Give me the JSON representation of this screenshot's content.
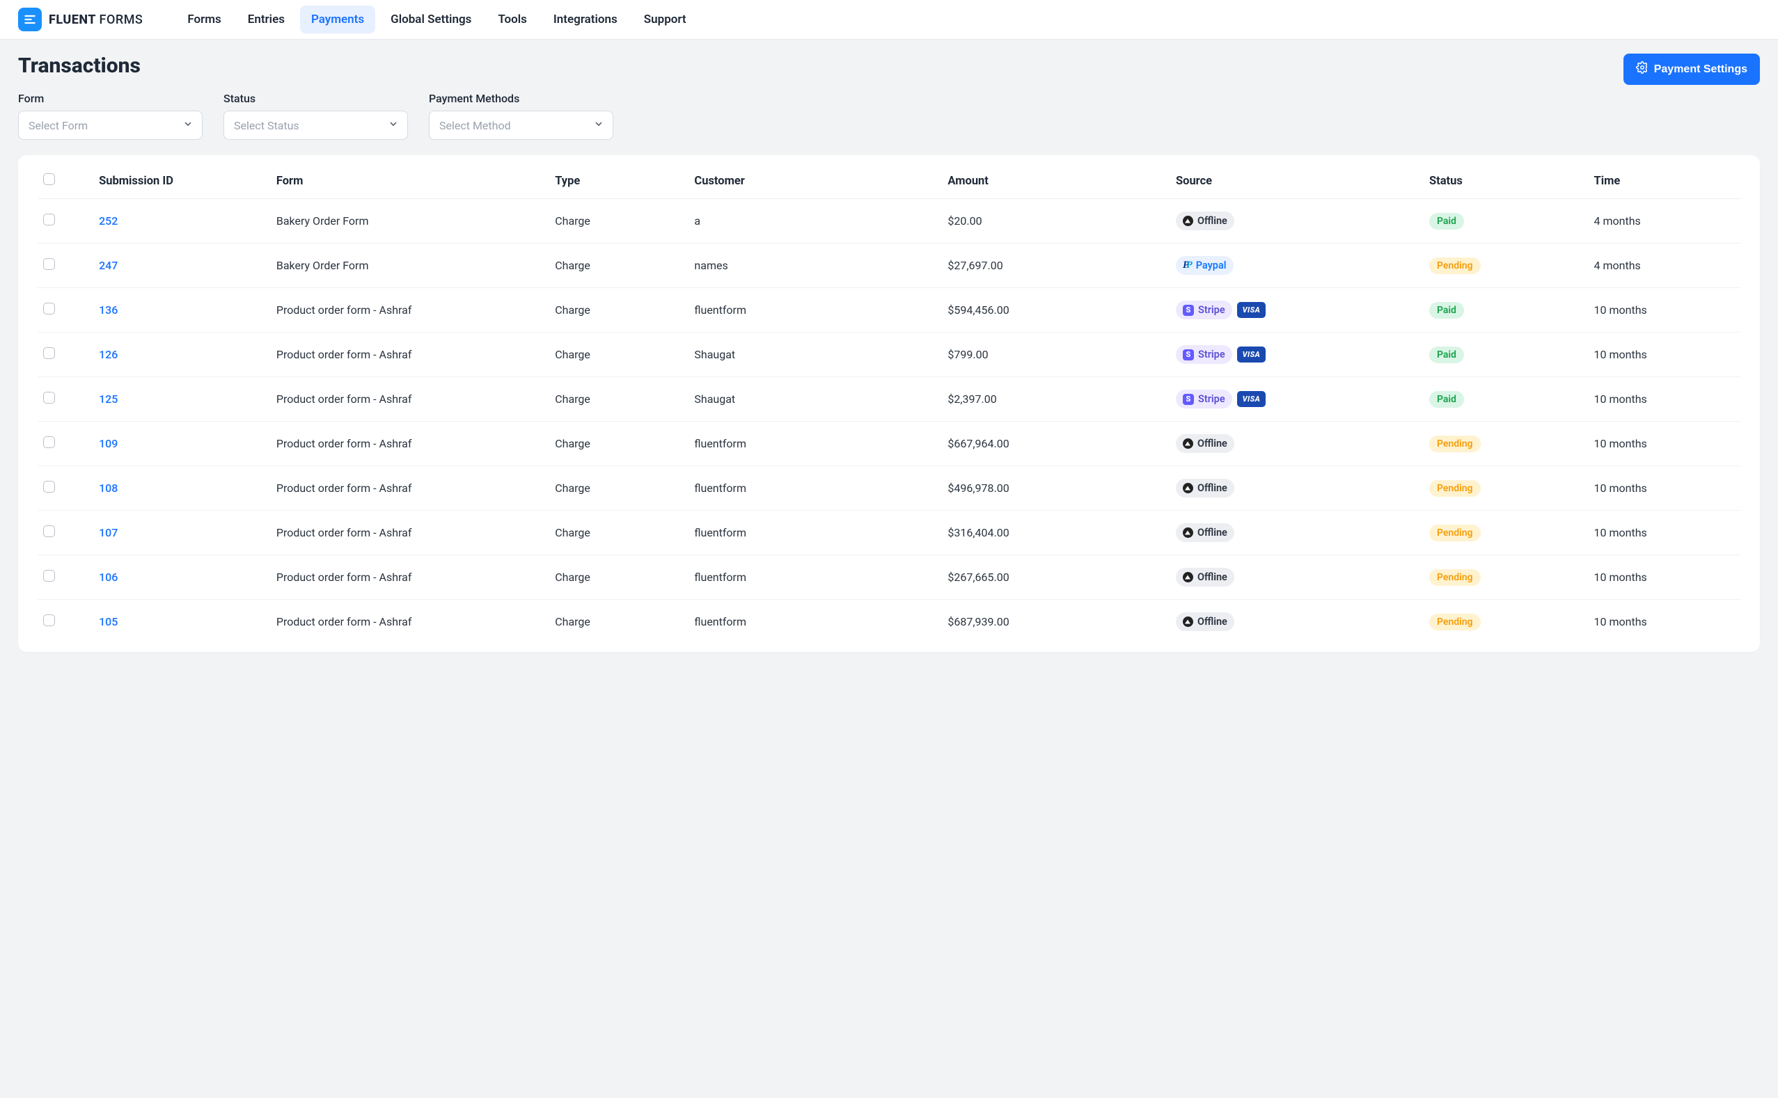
{
  "brand": {
    "name_bold": "FLUENT",
    "name_thin": "FORMS"
  },
  "nav": {
    "items": [
      {
        "label": "Forms"
      },
      {
        "label": "Entries"
      },
      {
        "label": "Payments",
        "active": true
      },
      {
        "label": "Global Settings"
      },
      {
        "label": "Tools"
      },
      {
        "label": "Integrations"
      },
      {
        "label": "Support"
      }
    ]
  },
  "page": {
    "title": "Transactions",
    "settings_button": "Payment Settings"
  },
  "filters": {
    "form": {
      "label": "Form",
      "placeholder": "Select Form"
    },
    "status": {
      "label": "Status",
      "placeholder": "Select Status"
    },
    "method": {
      "label": "Payment Methods",
      "placeholder": "Select Method"
    }
  },
  "table": {
    "columns": {
      "id": "Submission ID",
      "form": "Form",
      "type": "Type",
      "customer": "Customer",
      "amount": "Amount",
      "source": "Source",
      "status": "Status",
      "time": "Time"
    },
    "source_labels": {
      "offline": "Offline",
      "paypal": "Paypal",
      "stripe": "Stripe",
      "visa": "VISA"
    },
    "rows": [
      {
        "id": "252",
        "form": "Bakery Order Form",
        "type": "Charge",
        "customer": "a",
        "amount": "$20.00",
        "source": "offline",
        "status": "Paid",
        "time": "4 months"
      },
      {
        "id": "247",
        "form": "Bakery Order Form",
        "type": "Charge",
        "customer": "names",
        "amount": "$27,697.00",
        "source": "paypal",
        "status": "Pending",
        "time": "4 months"
      },
      {
        "id": "136",
        "form": "Product order form - Ashraf",
        "type": "Charge",
        "customer": "fluentform",
        "amount": "$594,456.00",
        "source": "stripe_visa",
        "status": "Paid",
        "time": "10 months"
      },
      {
        "id": "126",
        "form": "Product order form - Ashraf",
        "type": "Charge",
        "customer": "Shaugat",
        "amount": "$799.00",
        "source": "stripe_visa",
        "status": "Paid",
        "time": "10 months"
      },
      {
        "id": "125",
        "form": "Product order form - Ashraf",
        "type": "Charge",
        "customer": "Shaugat",
        "amount": "$2,397.00",
        "source": "stripe_visa",
        "status": "Paid",
        "time": "10 months"
      },
      {
        "id": "109",
        "form": "Product order form - Ashraf",
        "type": "Charge",
        "customer": "fluentform",
        "amount": "$667,964.00",
        "source": "offline",
        "status": "Pending",
        "time": "10 months"
      },
      {
        "id": "108",
        "form": "Product order form - Ashraf",
        "type": "Charge",
        "customer": "fluentform",
        "amount": "$496,978.00",
        "source": "offline",
        "status": "Pending",
        "time": "10 months"
      },
      {
        "id": "107",
        "form": "Product order form - Ashraf",
        "type": "Charge",
        "customer": "fluentform",
        "amount": "$316,404.00",
        "source": "offline",
        "status": "Pending",
        "time": "10 months"
      },
      {
        "id": "106",
        "form": "Product order form - Ashraf",
        "type": "Charge",
        "customer": "fluentform",
        "amount": "$267,665.00",
        "source": "offline",
        "status": "Pending",
        "time": "10 months"
      },
      {
        "id": "105",
        "form": "Product order form - Ashraf",
        "type": "Charge",
        "customer": "fluentform",
        "amount": "$687,939.00",
        "source": "offline",
        "status": "Pending",
        "time": "10 months"
      }
    ]
  }
}
